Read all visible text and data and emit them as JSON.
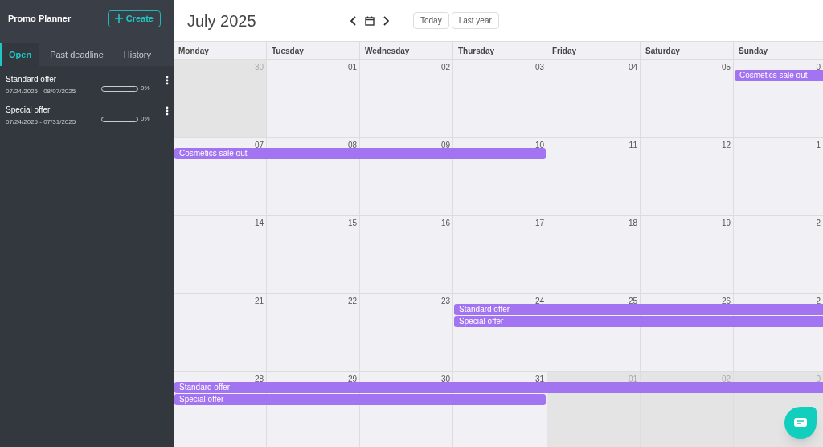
{
  "sidebar": {
    "title": "Promo Planner",
    "create_button": "Create",
    "tabs": [
      {
        "label": "Open",
        "selected": true
      },
      {
        "label": "Past deadline",
        "selected": false
      },
      {
        "label": "History",
        "selected": false
      }
    ],
    "promotions": [
      {
        "name": "Standard offer",
        "dates": "07/24/2025 - 08/07/2025",
        "level": 0,
        "percent": "0%"
      },
      {
        "name": "Special offer",
        "dates": "07/24/2025 - 07/31/2025",
        "level": 0,
        "percent": "0%"
      }
    ]
  },
  "calendar": {
    "title": "July 2025",
    "buttons": [
      "Today",
      "Last year"
    ],
    "weekdays": [
      "Monday",
      "Tuesday",
      "Wednesday",
      "Thursday",
      "Friday",
      "Saturday",
      "Sunday"
    ],
    "weeks": [
      {
        "days": [
          {
            "day": "30",
            "outside": true
          },
          {
            "day": "01",
            "outside": false
          },
          {
            "day": "02",
            "outside": false
          },
          {
            "day": "03",
            "outside": false
          },
          {
            "day": "04",
            "outside": false
          },
          {
            "day": "05",
            "outside": false
          },
          {
            "day": "0",
            "outside": false,
            "bars": [
              {
                "kind": "start",
                "label": "Cosmetics sale out"
              }
            ]
          }
        ]
      },
      {
        "days": [
          {
            "day": "07",
            "outside": false,
            "bars": [
              {
                "kind": "start",
                "label": "Cosmetics sale out"
              }
            ]
          },
          {
            "day": "08",
            "outside": false,
            "bars": [
              {
                "kind": "continue"
              }
            ]
          },
          {
            "day": "09",
            "outside": false,
            "bars": [
              {
                "kind": "continue"
              }
            ]
          },
          {
            "day": "10",
            "outside": false,
            "bars": [
              {
                "kind": "continue"
              }
            ]
          },
          {
            "day": "11",
            "outside": false
          },
          {
            "day": "12",
            "outside": false
          },
          {
            "day": "1",
            "outside": false
          }
        ]
      },
      {
        "days": [
          {
            "day": "14",
            "outside": false
          },
          {
            "day": "15",
            "outside": false
          },
          {
            "day": "16",
            "outside": false
          },
          {
            "day": "17",
            "outside": false
          },
          {
            "day": "18",
            "outside": false
          },
          {
            "day": "19",
            "outside": false
          },
          {
            "day": "2",
            "outside": false
          }
        ]
      },
      {
        "days": [
          {
            "day": "21",
            "outside": false
          },
          {
            "day": "22",
            "outside": false
          },
          {
            "day": "23",
            "outside": false
          },
          {
            "day": "24",
            "outside": false,
            "bars": [
              {
                "kind": "start",
                "label": "Standard offer"
              },
              {
                "kind": "start",
                "label": "Special offer"
              }
            ]
          },
          {
            "day": "25",
            "outside": false,
            "bars": [
              {
                "kind": "continue"
              },
              {
                "kind": "continue"
              }
            ]
          },
          {
            "day": "26",
            "outside": false,
            "bars": [
              {
                "kind": "continue"
              },
              {
                "kind": "continue"
              }
            ]
          },
          {
            "day": "2",
            "outside": false,
            "bars": [
              {
                "kind": "continue"
              },
              {
                "kind": "continue"
              }
            ]
          }
        ]
      },
      {
        "days": [
          {
            "day": "28",
            "outside": false,
            "bars": [
              {
                "kind": "start",
                "label": "Standard offer"
              },
              {
                "kind": "start",
                "label": "Special offer"
              }
            ]
          },
          {
            "day": "29",
            "outside": false,
            "bars": [
              {
                "kind": "continue"
              },
              {
                "kind": "continue"
              }
            ]
          },
          {
            "day": "30",
            "outside": false,
            "bars": [
              {
                "kind": "continue"
              },
              {
                "kind": "continue"
              }
            ]
          },
          {
            "day": "31",
            "outside": false,
            "bars": [
              {
                "kind": "continue"
              },
              {
                "kind": "continue"
              }
            ]
          },
          {
            "day": "01",
            "outside": true,
            "bars": [
              {
                "kind": "continue"
              }
            ]
          },
          {
            "day": "02",
            "outside": true,
            "bars": [
              {
                "kind": "continue"
              }
            ]
          },
          {
            "day": "0",
            "outside": true,
            "bars": [
              {
                "kind": "continue"
              }
            ]
          }
        ]
      }
    ]
  }
}
